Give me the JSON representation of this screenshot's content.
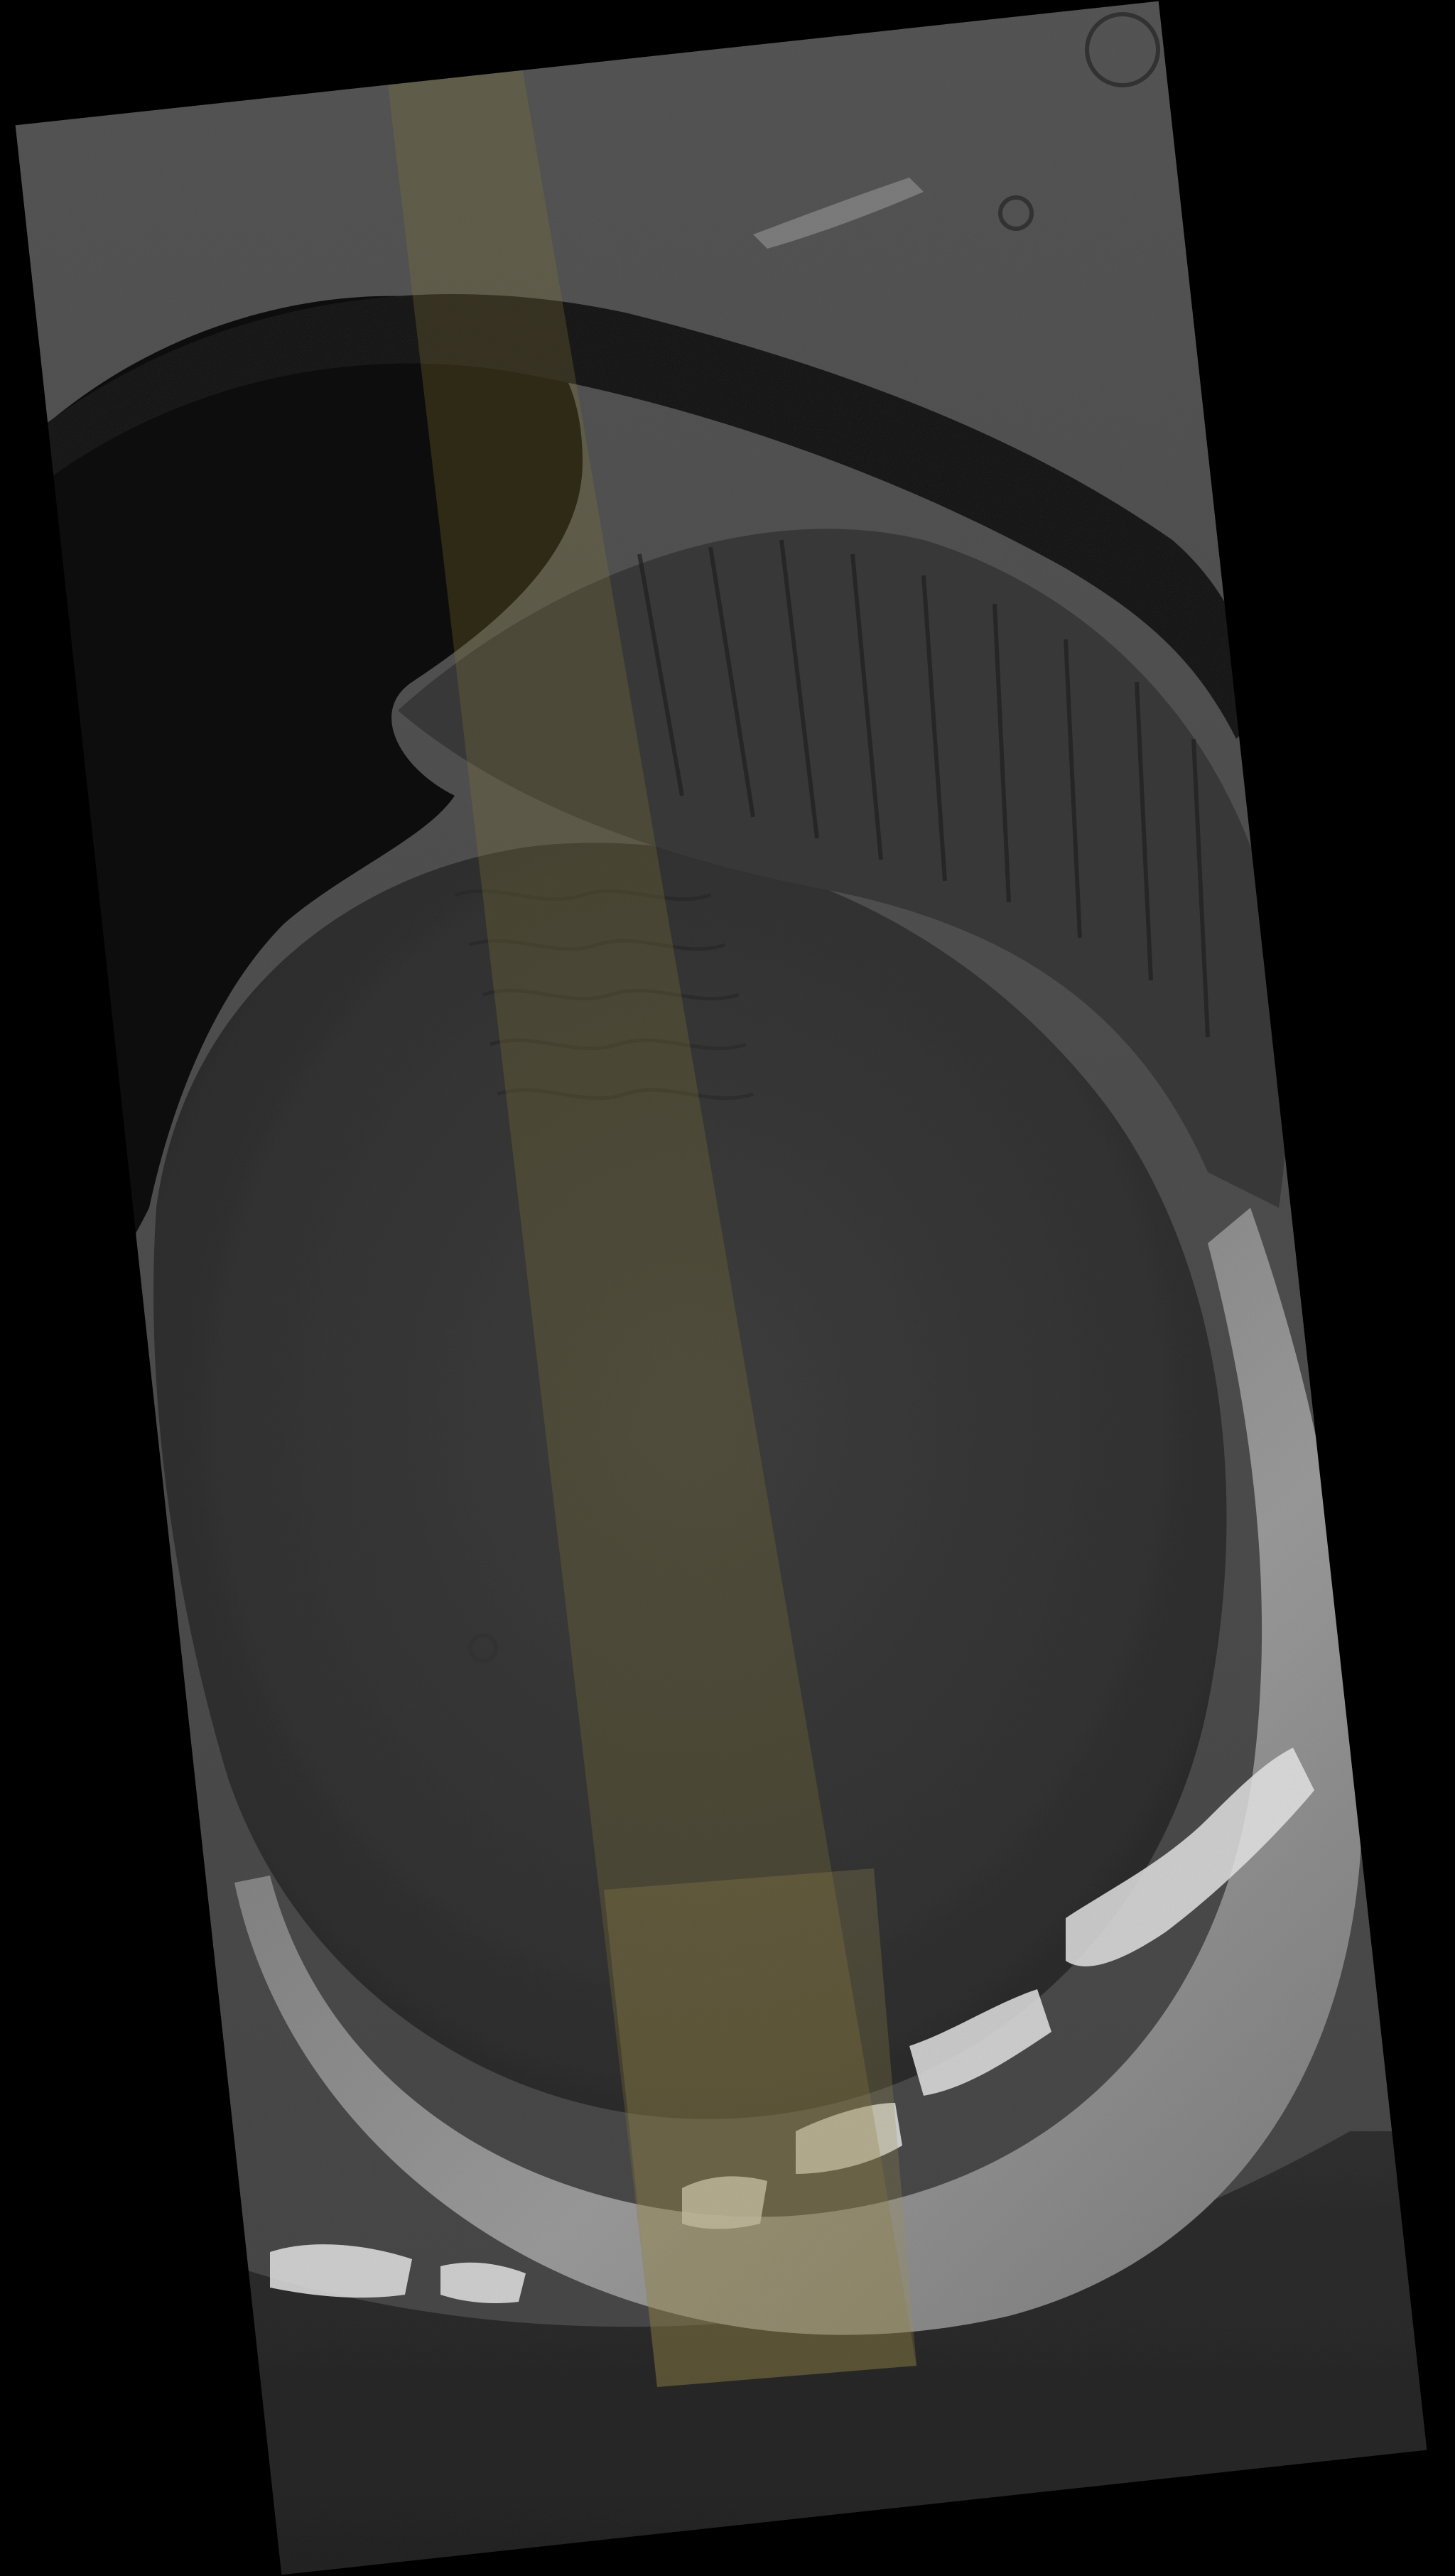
{
  "image": {
    "subject": "crater-orbital-image",
    "colors": {
      "background": "#000000",
      "terrain_dark": "#262626",
      "terrain_mid": "#4a4a4a",
      "terrain_light": "#8a8a8a",
      "frost_white": "#e8e8e8",
      "color_strip_tint": "#8a7a3a",
      "shadow": "#0b0b0b"
    }
  }
}
